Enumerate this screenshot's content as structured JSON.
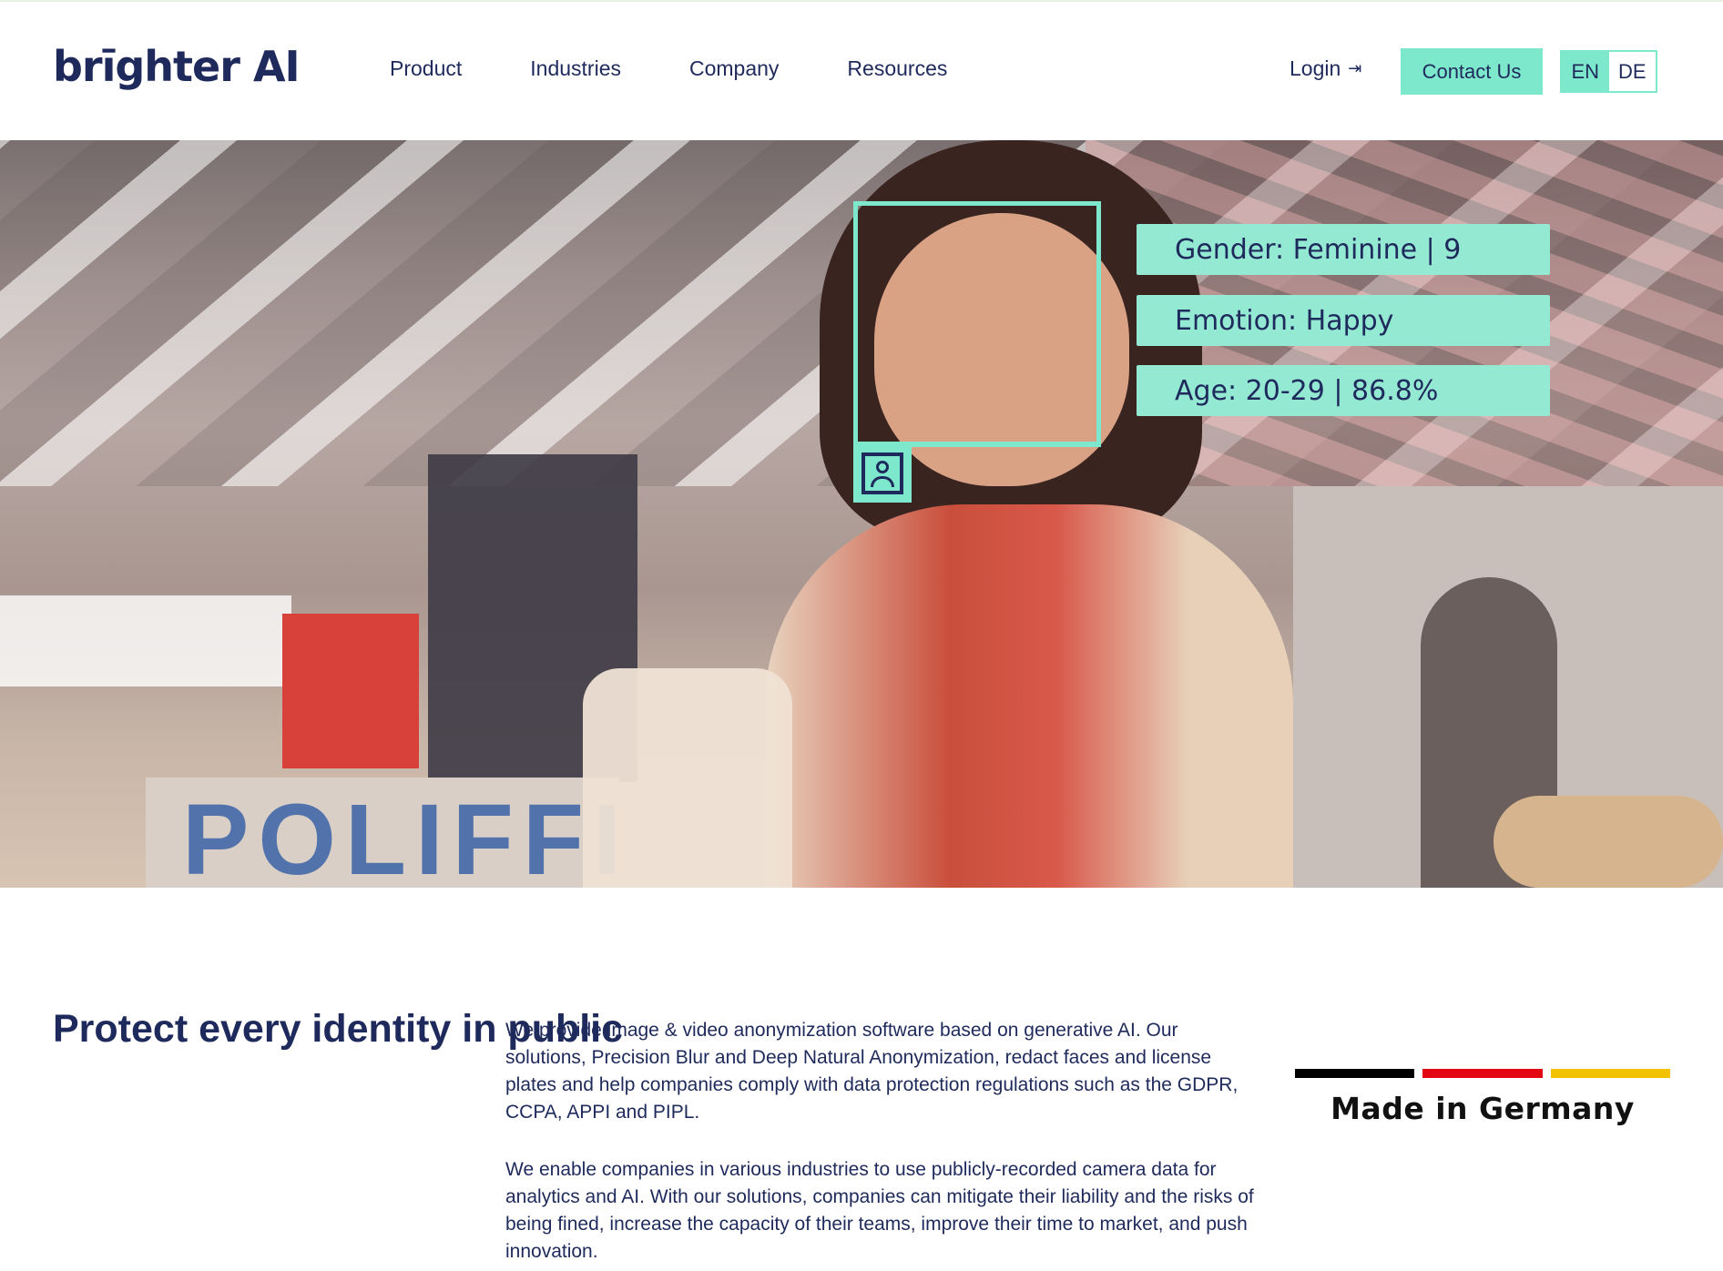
{
  "header": {
    "logo": "brīghter AI",
    "nav": [
      "Product",
      "Industries",
      "Company",
      "Resources"
    ],
    "login_label": "Login",
    "login_icon": "login-arrow-icon",
    "contact_label": "Contact Us",
    "languages": [
      "EN",
      "DE"
    ],
    "active_language": "EN"
  },
  "hero": {
    "overlay_tags": [
      "Gender: Feminine | 9",
      "Emotion: Happy",
      "Age: 20-29 | 86.8%"
    ],
    "badge_icon": "person-id-icon",
    "accent_color": "#7de8cc"
  },
  "intro": {
    "headline": "Protect every identity in public",
    "paragraph_1": "We provide image & video anonymization software based on generative AI. Our solutions, Precision Blur and Deep Natural Anonymization, redact faces and license plates and help companies comply with data protection regulations such as the GDPR, CCPA, APPI and PIPL.",
    "paragraph_2": "We enable companies in various industries to use publicly-recorded camera data for analytics and AI. With our solutions, companies can mitigate their liability and the risks of being fined, increase the capacity of their teams, improve their time to market, and push innovation."
  },
  "made_in": {
    "label": "Made in Germany",
    "flag_colors": [
      "#000000",
      "#e30613",
      "#f2c200"
    ]
  }
}
